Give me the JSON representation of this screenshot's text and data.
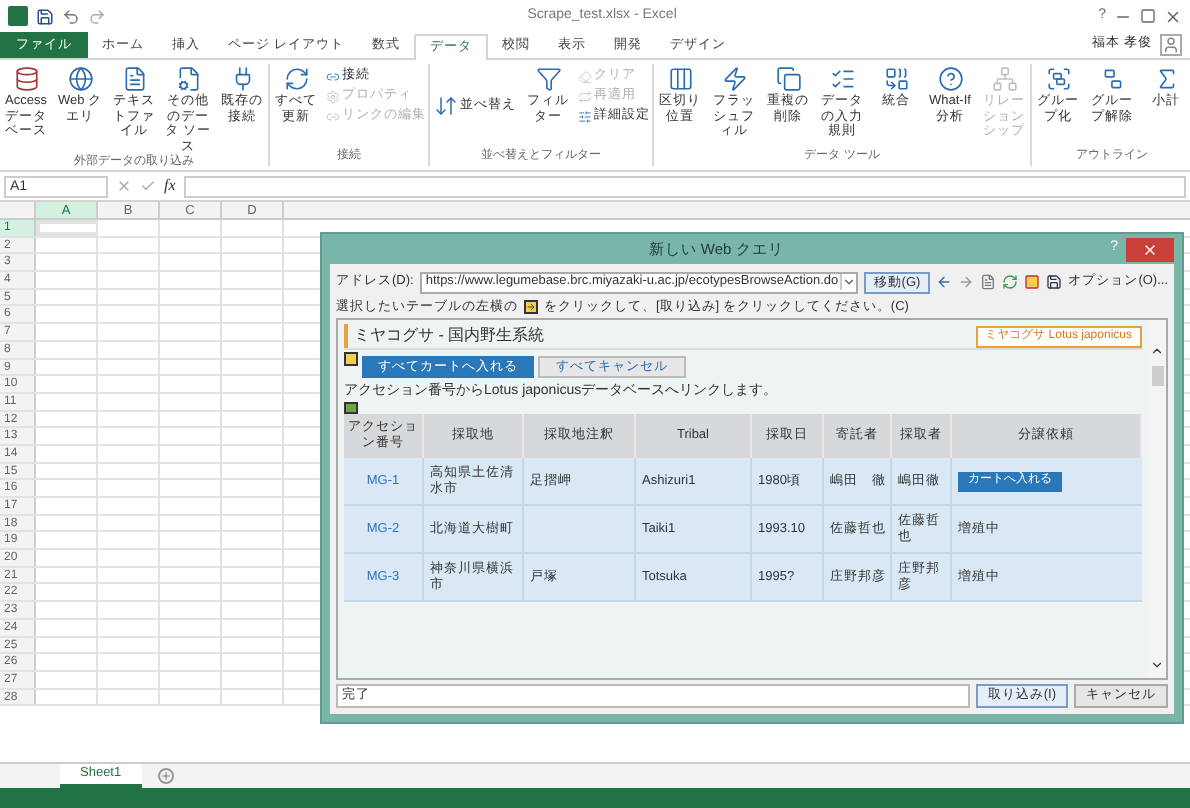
{
  "window": {
    "title": "Scrape_test.xlsx - Excel",
    "help": "?",
    "user": "福本 孝俊"
  },
  "file_tab": "ファイル",
  "tabs": [
    {
      "label": "ホーム",
      "selected": false
    },
    {
      "label": "挿入",
      "selected": false
    },
    {
      "label": "ページ レイアウト",
      "selected": false
    },
    {
      "label": "数式",
      "selected": false
    },
    {
      "label": "データ",
      "selected": true
    },
    {
      "label": "校閲",
      "selected": false
    },
    {
      "label": "表示",
      "selected": false
    },
    {
      "label": "開発",
      "selected": false
    },
    {
      "label": "デザイン",
      "selected": false
    }
  ],
  "ribbon": [
    {
      "title": "外部データの取り込み",
      "buttons": [
        {
          "label": "Access データベース",
          "kind": "large",
          "disabled": false
        },
        {
          "label": "Web クエリ",
          "kind": "large",
          "disabled": false
        },
        {
          "label": "テキストファイル",
          "kind": "large",
          "disabled": false
        },
        {
          "label": "その他のデータ ソース",
          "kind": "large",
          "disabled": false
        },
        {
          "label": "既存の接続",
          "kind": "large",
          "disabled": false
        }
      ]
    },
    {
      "title": "接続",
      "buttons": [
        {
          "label": "すべて更新",
          "kind": "large",
          "disabled": false
        },
        {
          "label": "接続",
          "kind": "small",
          "disabled": false
        },
        {
          "label": "プロパティ",
          "kind": "small",
          "disabled": true
        },
        {
          "label": "リンクの編集",
          "kind": "small",
          "disabled": true
        }
      ]
    },
    {
      "title": "並べ替えとフィルター",
      "buttons": [
        {
          "label": "並べ替え",
          "kind": "medium",
          "disabled": false
        },
        {
          "label": "フィルター",
          "kind": "large",
          "disabled": false
        },
        {
          "label": "クリア",
          "kind": "small",
          "disabled": true
        },
        {
          "label": "再適用",
          "kind": "small",
          "disabled": true
        },
        {
          "label": "詳細設定",
          "kind": "small",
          "disabled": false
        }
      ]
    },
    {
      "title": "データ ツール",
      "buttons": [
        {
          "label": "区切り位置",
          "kind": "large",
          "disabled": false
        },
        {
          "label": "フラッシュフィル",
          "kind": "large",
          "disabled": false
        },
        {
          "label": "重複の削除",
          "kind": "large",
          "disabled": false
        },
        {
          "label": "データの入力規則",
          "kind": "large",
          "disabled": false
        },
        {
          "label": "統合",
          "kind": "large",
          "disabled": false
        },
        {
          "label": "What-If 分析",
          "kind": "large",
          "disabled": false
        },
        {
          "label": "リレーションシップ",
          "kind": "large",
          "disabled": true
        }
      ]
    },
    {
      "title": "アウトライン",
      "buttons": [
        {
          "label": "グループ化",
          "kind": "large",
          "disabled": false
        },
        {
          "label": "グループ解除",
          "kind": "large",
          "disabled": false
        },
        {
          "label": "小計",
          "kind": "large",
          "disabled": false
        }
      ]
    }
  ],
  "formula_bar": {
    "name_box": "A1",
    "fx": "fx"
  },
  "sheet": {
    "columns": [
      "A",
      "B",
      "C",
      "D"
    ],
    "rows": [
      "1",
      "2",
      "3",
      "4",
      "5",
      "6",
      "7",
      "8",
      "9",
      "10",
      "11",
      "12",
      "13",
      "14",
      "15",
      "16",
      "17",
      "18",
      "19",
      "20",
      "21",
      "22",
      "23",
      "24",
      "25",
      "26",
      "27",
      "28"
    ]
  },
  "sheet_tabs": [
    {
      "label": "Sheet1",
      "selected": true
    }
  ],
  "dialog": {
    "title": "新しい Web クエリ",
    "help": "?",
    "address_label": "アドレス(D):",
    "address": "https://www.legumebase.brc.miyazaki-u.ac.jp/ecotypesBrowseAction.do",
    "go": "移動(G)",
    "options": "オプション(O)...",
    "instruction_before": "選択したいテーブルの左横の",
    "instruction_after": "をクリックして、[取り込み] をクリックしてください。(C)",
    "page": {
      "heading": "ミヤコグサ - 国内野生系統",
      "badge": "ミヤコグサ Lotus japonicus",
      "buttons": [
        {
          "label": "すべてカートへ入れる",
          "kind": "primary"
        },
        {
          "label": "すべてキャンセル",
          "kind": "secondary"
        }
      ],
      "note": "アクセション番号からLotus japonicusデータベースへリンクします。",
      "columns": [
        "アクセション番号",
        "採取地",
        "採取地注釈",
        "Tribal",
        "採取日",
        "寄託者",
        "採取者",
        "分譲依頼"
      ],
      "rows": [
        {
          "cells": [
            "MG-1",
            "高知県土佐清水市",
            "足摺岬",
            "Ashizuri1",
            "1980頃",
            "嶋田　徹",
            "嶋田徹"
          ],
          "request": {
            "kind": "button",
            "text": "カートへ入れる"
          }
        },
        {
          "cells": [
            "MG-2",
            "北海道大樹町",
            "",
            "Taiki1",
            "1993.10",
            "佐藤哲也",
            "佐藤哲也"
          ],
          "request": {
            "kind": "text",
            "text": "増殖中"
          }
        },
        {
          "cells": [
            "MG-3",
            "神奈川県横浜市",
            "戸塚",
            "Totsuka",
            "1995?",
            "庄野邦彦",
            "庄野邦彦"
          ],
          "request": {
            "kind": "text",
            "text": "増殖中"
          }
        }
      ]
    },
    "status": "完了",
    "import": "取り込み(I)",
    "cancel": "キャンセル"
  }
}
